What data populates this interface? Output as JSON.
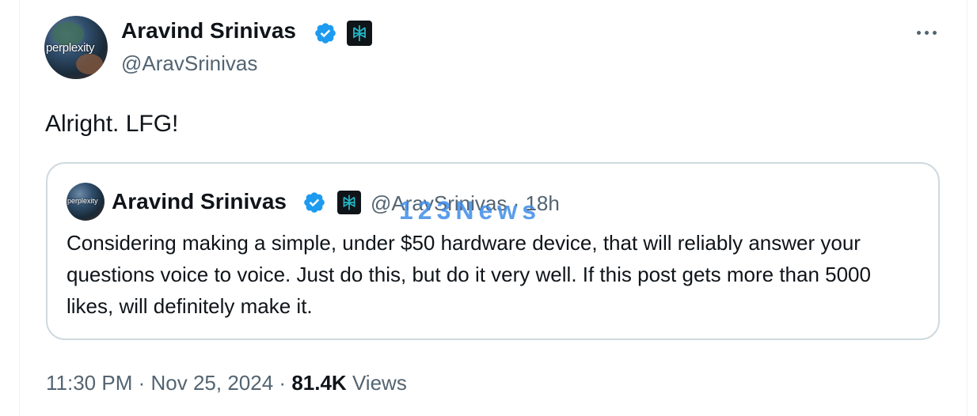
{
  "tweet": {
    "author": {
      "name": "Aravind Srinivas",
      "handle": "@AravSrinivas",
      "avatar_text": "perplexity",
      "verified": true
    },
    "text": "Alright. LFG!",
    "timestamp": {
      "time": "11:30 PM",
      "date": "Nov 25, 2024"
    },
    "views": {
      "count": "81.4K",
      "label": "Views"
    }
  },
  "quoted_tweet": {
    "author": {
      "name": "Aravind Srinivas",
      "handle": "@AravSrinivas",
      "avatar_text": "perplexity",
      "verified": true
    },
    "age": "18h",
    "separator": "·",
    "text": "Considering making a simple, under $50 hardware device, that will reliably answer your questions voice to voice. Just do this, but do it very well. If this post gets more than 5000 likes, will definitely make it."
  },
  "watermark": "123News",
  "colors": {
    "text_primary": "#0f1419",
    "text_secondary": "#536471",
    "verified_blue": "#1d9bf0",
    "border": "#cfd9de"
  },
  "icons": {
    "verified": "verified-badge-icon",
    "affiliation": "perplexity-affiliation-icon",
    "more": "more-options-icon"
  }
}
